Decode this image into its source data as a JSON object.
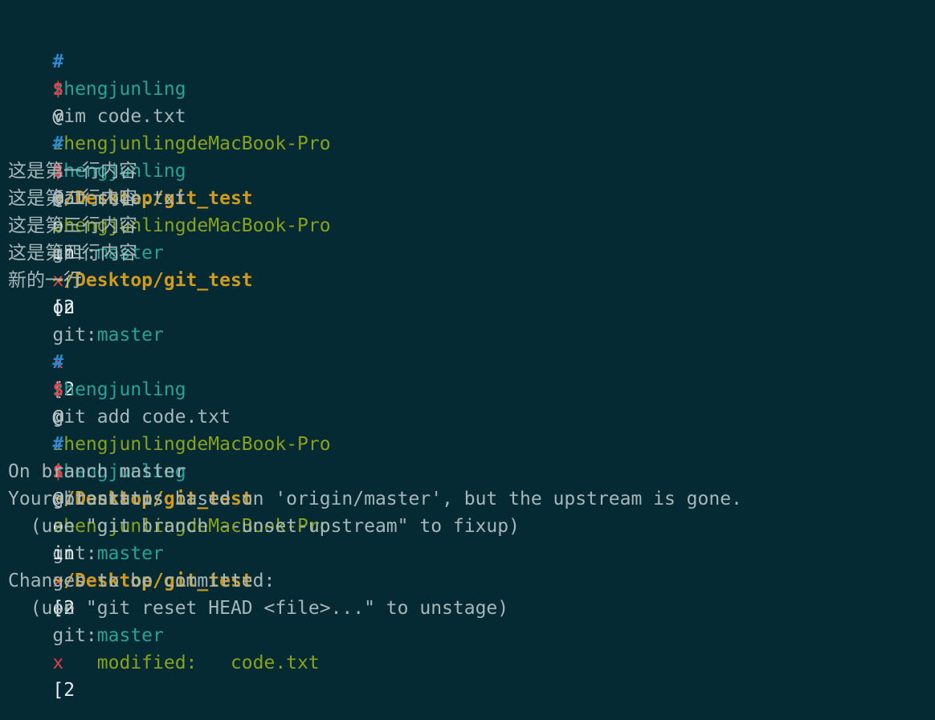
{
  "prompt": {
    "hash": "#",
    "user": "zhengjunling",
    "at": "@",
    "host": "zhengjunlingdeMacBook-Pro",
    "in": "in",
    "path": "~/Desktop/git_test",
    "on": "on",
    "git_label": "git:",
    "branch": "master",
    "dirty": "x",
    "bracket": "[2",
    "dollar": "$"
  },
  "blocks": [
    {
      "command": "vim code.txt",
      "output": []
    },
    {
      "command": "cat code.txt",
      "output": [
        "这是第一行内容",
        "这是第二行内容",
        "这是第三行内容",
        "这是第四行内容",
        "新的一行"
      ]
    },
    {
      "command": "git add code.txt",
      "output": []
    },
    {
      "command": "git status",
      "output": [
        "On branch master",
        "Your branch is based on 'origin/master', but the upstream is gone.",
        "  (use \"git branch --unset-upstream\" to fixup)",
        "",
        "Changes to be committed:",
        "  (use \"git reset HEAD <file>...\" to unstage)",
        ""
      ],
      "modified_line": "        modified:   code.txt"
    }
  ],
  "colors": {
    "background": "#052a33",
    "hash": "#2f88d0",
    "user": "#29a298",
    "host": "#8aa11c",
    "path": "#d09a1f",
    "dirty": "#e0404a",
    "text": "#a7b6b9"
  }
}
